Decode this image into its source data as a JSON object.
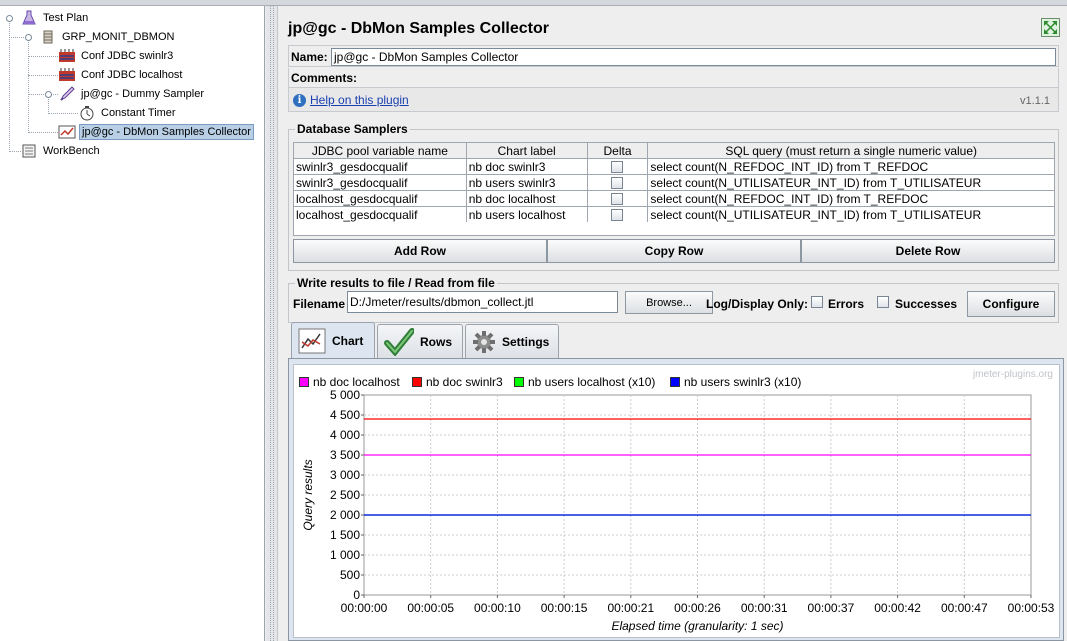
{
  "tree": {
    "items": [
      {
        "label": "Test Plan",
        "icon": "flask-icon"
      },
      {
        "label": "GRP_MONIT_DBMON",
        "icon": "spool-icon"
      },
      {
        "label": "Conf JDBC swinlr3",
        "icon": "jdbc-config-icon"
      },
      {
        "label": "Conf JDBC localhost",
        "icon": "jdbc-config-icon"
      },
      {
        "label": "jp@gc - Dummy Sampler",
        "icon": "pipette-icon"
      },
      {
        "label": "Constant Timer",
        "icon": "timer-icon"
      },
      {
        "label": "jp@gc - DbMon Samples Collector",
        "icon": "chart-listener-icon"
      },
      {
        "label": "WorkBench",
        "icon": "workbench-icon"
      }
    ]
  },
  "panel": {
    "title": "jp@gc - DbMon Samples Collector",
    "name_label": "Name:",
    "name_value": "jp@gc - DbMon Samples Collector",
    "comments_label": "Comments:",
    "help_link": "Help on this plugin",
    "version": "v1.1.1"
  },
  "samplers": {
    "title": "Database Samplers",
    "headers": [
      "JDBC pool variable name",
      "Chart label",
      "Delta",
      "SQL query (must return a single numeric value)"
    ],
    "rows": [
      {
        "pool": "swinlr3_gesdocqualif",
        "label": "nb doc swinlr3",
        "query": "select count(N_REFDOC_INT_ID) from T_REFDOC"
      },
      {
        "pool": "swinlr3_gesdocqualif",
        "label": "nb users swinlr3",
        "query": "select count(N_UTILISATEUR_INT_ID) from T_UTILISATEUR"
      },
      {
        "pool": "localhost_gesdocqualif",
        "label": "nb doc localhost",
        "query": "select count(N_REFDOC_INT_ID) from T_REFDOC"
      },
      {
        "pool": "localhost_gesdocqualif",
        "label": "nb users localhost",
        "query": "select count(N_UTILISATEUR_INT_ID) from T_UTILISATEUR"
      }
    ],
    "add_row": "Add Row",
    "copy_row": "Copy Row",
    "delete_row": "Delete Row"
  },
  "file": {
    "title": "Write results to file / Read from file",
    "filename_label": "Filename",
    "filename_value": "D:/Jmeter/results/dbmon_collect.jtl",
    "browse": "Browse...",
    "log_only": "Log/Display Only:",
    "errors": "Errors",
    "successes": "Successes",
    "configure": "Configure"
  },
  "tabs": [
    {
      "label": "Chart",
      "icon": "chart-icon",
      "active": true
    },
    {
      "label": "Rows",
      "icon": "checkmark-icon",
      "active": false
    },
    {
      "label": "Settings",
      "icon": "gear-icon",
      "active": false
    }
  ],
  "chart": {
    "watermark": "jmeter-plugins.org"
  },
  "chart_data": {
    "type": "line",
    "xlabel": "Elapsed time (granularity: 1 sec)",
    "ylabel": "Query results",
    "ylim": [
      0,
      5000
    ],
    "yticks": [
      "0",
      "500",
      "1 000",
      "1 500",
      "2 000",
      "2 500",
      "3 000",
      "3 500",
      "4 000",
      "4 500",
      "5 000"
    ],
    "xticks": [
      "00:00:00",
      "00:00:05",
      "00:00:10",
      "00:00:15",
      "00:00:21",
      "00:00:26",
      "00:00:31",
      "00:00:37",
      "00:00:42",
      "00:00:47",
      "00:00:53"
    ],
    "grid": true,
    "legend_position": "top-left",
    "series": [
      {
        "name": "nb doc localhost",
        "color": "#ff00ff",
        "values": [
          3500,
          3500
        ]
      },
      {
        "name": "nb doc swinlr3",
        "color": "#ff0000",
        "values": [
          4400,
          4400
        ]
      },
      {
        "name": "nb users localhost (x10)",
        "color": "#00ff00",
        "values": [
          2000,
          2000
        ]
      },
      {
        "name": "nb users swinlr3 (x10)",
        "color": "#0000ff",
        "values": [
          2000,
          2000
        ]
      }
    ]
  }
}
